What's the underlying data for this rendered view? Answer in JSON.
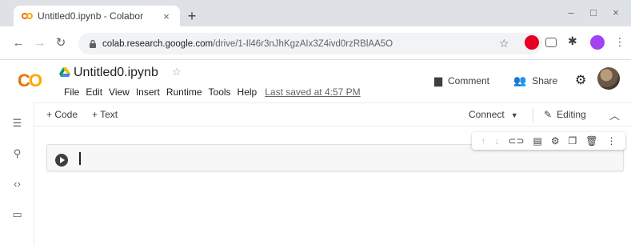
{
  "browser": {
    "tab_title": "Untitled0.ipynb - Colabor",
    "tab_close": "×",
    "new_tab": "+",
    "window_minimize": "–",
    "window_maximize": "□",
    "window_close": "×",
    "url_host": "colab.research.google.com",
    "url_path": "/drive/1-Il46r3nJhKgzAIx3Z4ivd0rzRBlAA5O"
  },
  "colab": {
    "logo": "CO",
    "notebook_title": "Untitled0.ipynb",
    "menu": [
      "File",
      "Edit",
      "View",
      "Insert",
      "Runtime",
      "Tools",
      "Help"
    ],
    "last_saved": "Last saved at 4:57 PM",
    "comment_label": "Comment",
    "share_label": "Share"
  },
  "toolbar": {
    "add_code": "+ Code",
    "add_text": "+ Text",
    "connect": "Connect",
    "editing": "Editing"
  },
  "colors": {
    "logo_orange": "#e8710a",
    "logo_yellow": "#f9ab00",
    "tab_strip": "#dee1e6",
    "cell_background": "#f7f7f7"
  }
}
